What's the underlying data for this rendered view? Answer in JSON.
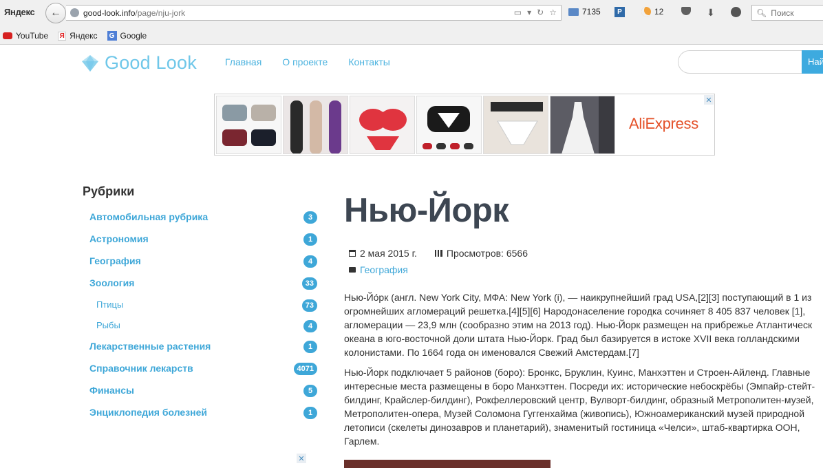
{
  "browser": {
    "brand": "Яндекс",
    "url_host": "good-look.info",
    "url_path": "/page/nju-jork",
    "mail_count": "7135",
    "p_badge": "P",
    "weather_temp": "12",
    "search_placeholder": "Поиск",
    "bookmarks": [
      "YouTube",
      "Яндекс",
      "Google"
    ]
  },
  "site": {
    "logo_text": "Good Look",
    "nav": [
      "Главная",
      "О проекте",
      "Контакты"
    ],
    "search_button": "Найти"
  },
  "ad": {
    "brand": "AliExpress",
    "close": "✕"
  },
  "sidebar": {
    "title": "Рубрики",
    "categories": [
      {
        "label": "Автомобильная рубрика",
        "count": "3"
      },
      {
        "label": "Астрономия",
        "count": "1"
      },
      {
        "label": "География",
        "count": "4"
      },
      {
        "label": "Зоология",
        "count": "33"
      },
      {
        "label": "Птицы",
        "count": "73"
      },
      {
        "label": "Рыбы",
        "count": "4"
      },
      {
        "label": "Лекарственные растения",
        "count": "1"
      },
      {
        "label": "Справочник лекарств",
        "count": "4071"
      },
      {
        "label": "Финансы",
        "count": "5"
      },
      {
        "label": "Энциклопедия болезней",
        "count": "1"
      }
    ]
  },
  "article": {
    "title": "Нью-Йорк",
    "date": "2 мая 2015 г.",
    "views": "Просмотров: 6566",
    "category": "География",
    "para1": [
      "Нью-Йо́рк (англ. New York City, МФА: New York (i), — наикрупнейший град USA,[2][3] поступающий в 1 из",
      "огромнейших агломераций решетка.[4][5][6] Народонаселение городка сочиняет 8 405 837 человек [1],",
      "агломерации — 23,9 млн (сообразно этим на 2013 год). Нью-Йорк размещен на прибрежье Атлантическ",
      "океана в юго-восточной доли штата Нью-Йорк. Град был базируется в истоке XVII века голландскими",
      "колонистами. По 1664 года он именовался Свежий Амстердам.[7]"
    ],
    "para2": [
      "Нью-Йорк подключает 5 районов (боро): Бронкс, Бруклин, Куинс, Манхэттен и Строен-Айленд. Главные",
      "интересные места размещены в боро Манхэттен. Посреди их: исторические небоскрёбы (Эмпайр-стейт-",
      "билдинг, Крайслер-билдинг), Рокфеллеровский центр, Вулворт-билдинг, образный Метрополитен-музей,",
      "Метрополитен-опера, Музей Соломона Гуггенхайма (живопись), Южноамериканский музей природной",
      "летописи (скелеты динозавров и планетарий), знаменитый гостиница «Челси», штаб-квартирка ООН,",
      "Гарлем."
    ]
  },
  "colors": {
    "accent": "#3ea7d8",
    "logo": "#6fc7e9",
    "title": "#3d4652",
    "ad_brand": "#e4522a"
  }
}
